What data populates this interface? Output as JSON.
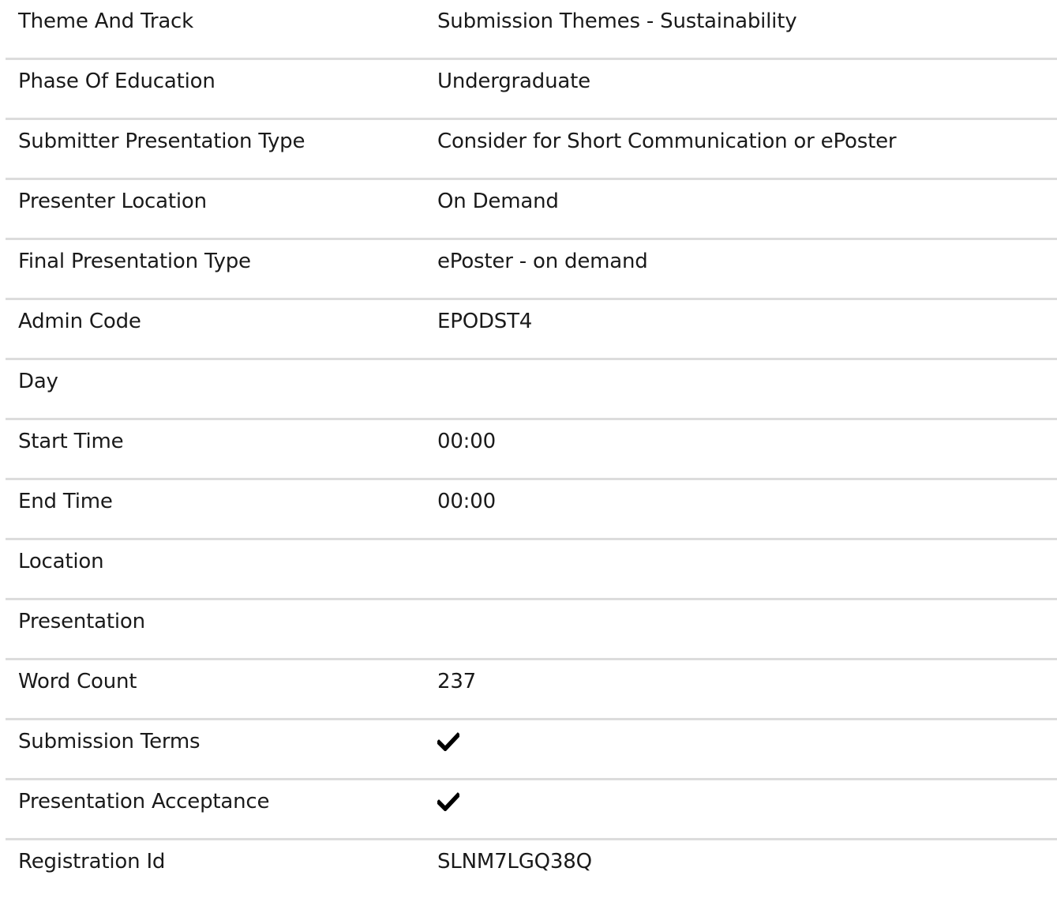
{
  "details": {
    "rows": [
      {
        "label": "Theme And Track",
        "value": "Submission Themes - Sustainability"
      },
      {
        "label": "Phase Of Education",
        "value": "Undergraduate"
      },
      {
        "label": "Submitter Presentation Type",
        "value": "Consider for Short Communication or ePoster"
      },
      {
        "label": "Presenter Location",
        "value": "On Demand"
      },
      {
        "label": "Final Presentation Type",
        "value": "ePoster - on demand"
      },
      {
        "label": "Admin Code",
        "value": "EPODST4"
      },
      {
        "label": "Day",
        "value": ""
      },
      {
        "label": "Start Time",
        "value": "00:00"
      },
      {
        "label": "End Time",
        "value": "00:00"
      },
      {
        "label": "Location",
        "value": ""
      },
      {
        "label": "Presentation",
        "value": ""
      },
      {
        "label": "Word Count",
        "value": "237"
      },
      {
        "label": "Submission Terms",
        "value_icon": "check-icon",
        "checked": true
      },
      {
        "label": "Presentation Acceptance",
        "value_icon": "check-icon",
        "checked": true
      },
      {
        "label": "Registration Id",
        "value": "SLNM7LGQ38Q"
      }
    ]
  }
}
